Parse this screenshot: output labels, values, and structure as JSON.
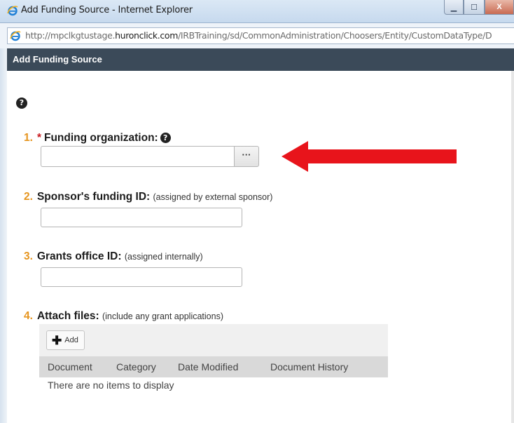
{
  "window": {
    "title": "Add Funding Source - Internet Explorer",
    "url_prefix": "http://mpclkgtustage.",
    "url_domain": "huronclick.com",
    "url_suffix": "/IRBTraining/sd/CommonAdministration/Choosers/Entity/CustomDataType/D",
    "minimize": "▁",
    "maximize": "☐",
    "close": "X"
  },
  "dialog": {
    "title": "Add Funding Source",
    "help": "?"
  },
  "questions": [
    {
      "number": "1.",
      "required_mark": "*",
      "label": "Funding organization:",
      "help": "?",
      "chooser_button": "···"
    },
    {
      "number": "2.",
      "label": "Sponsor's funding ID:",
      "note": "(assigned by external sponsor)",
      "value": ""
    },
    {
      "number": "3.",
      "label": "Grants office ID:",
      "note": "(assigned internally)",
      "value": ""
    },
    {
      "number": "4.",
      "label": "Attach files:",
      "note": "(include any grant applications)"
    }
  ],
  "attachments": {
    "add_label": "Add",
    "add_icon": "plus-icon",
    "columns": [
      "Document",
      "Category",
      "Date Modified",
      "Document History"
    ],
    "empty_message": "There are no items to display"
  },
  "colors": {
    "header_bg": "#3b4a59",
    "question_number": "#e6951f",
    "required": "#c8191e",
    "arrow": "#e8141b"
  }
}
